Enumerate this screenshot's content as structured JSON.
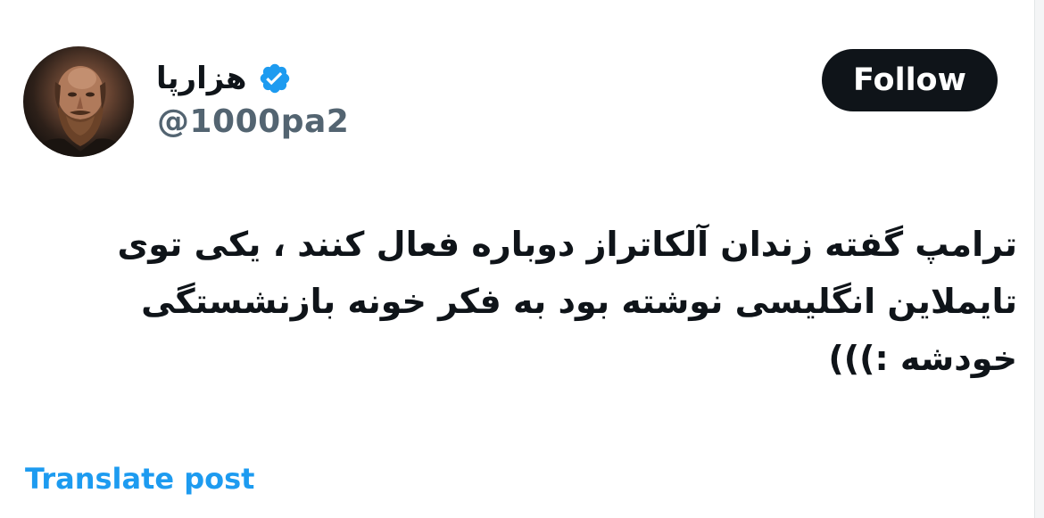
{
  "author": {
    "display_name": "هزارپا",
    "handle": "@1000pa2",
    "verified": true,
    "verified_badge_icon": "verified-badge-icon",
    "avatar_icon": "avatar"
  },
  "actions": {
    "follow_label": "Follow"
  },
  "post": {
    "text": "ترامپ گفته زندان آلکاتراز دوباره فعال کنند ، یکی توی تایملاین انگلیسی نوشته بود به فکر خونه بازنشستگی خودشه :)))"
  },
  "footer": {
    "translate_label": "Translate post"
  },
  "colors": {
    "accent": "#1d9bf0",
    "text_primary": "#0f1419",
    "text_secondary": "#536471",
    "follow_bg": "#0f1419",
    "background": "#ffffff"
  }
}
